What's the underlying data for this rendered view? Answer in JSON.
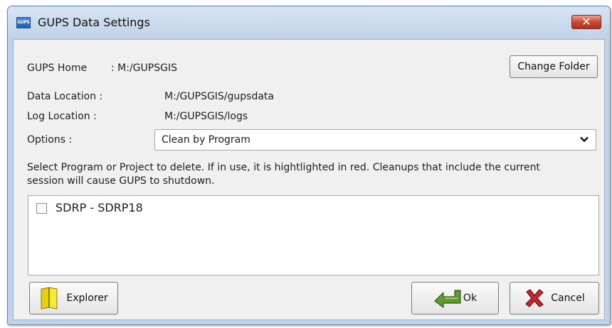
{
  "window": {
    "title": "GUPS Data Settings",
    "icon_text": "GUPS",
    "close_label": "✕"
  },
  "settings": {
    "gups_home_label": "GUPS Home",
    "gups_home_value": ": M:/GUPSGIS",
    "data_location_label": "Data Location  :",
    "data_location_value": "M:/GUPSGIS/gupsdata",
    "log_location_label": "Log Location  :",
    "log_location_value": "M:/GUPSGIS/logs",
    "change_folder_label": "Change Folder"
  },
  "options": {
    "label": "Options :",
    "selected": "Clean by Program"
  },
  "instructions": {
    "line1": "Select Program or Project to delete. If in use, it is hightlighted in red. Cleanups that include the current",
    "line2": "session will cause GUPS to shutdown."
  },
  "items": [
    {
      "label": "SDRP - SDRP18",
      "checked": false
    }
  ],
  "buttons": {
    "explorer": "Explorer",
    "ok": "Ok",
    "cancel": "Cancel"
  }
}
